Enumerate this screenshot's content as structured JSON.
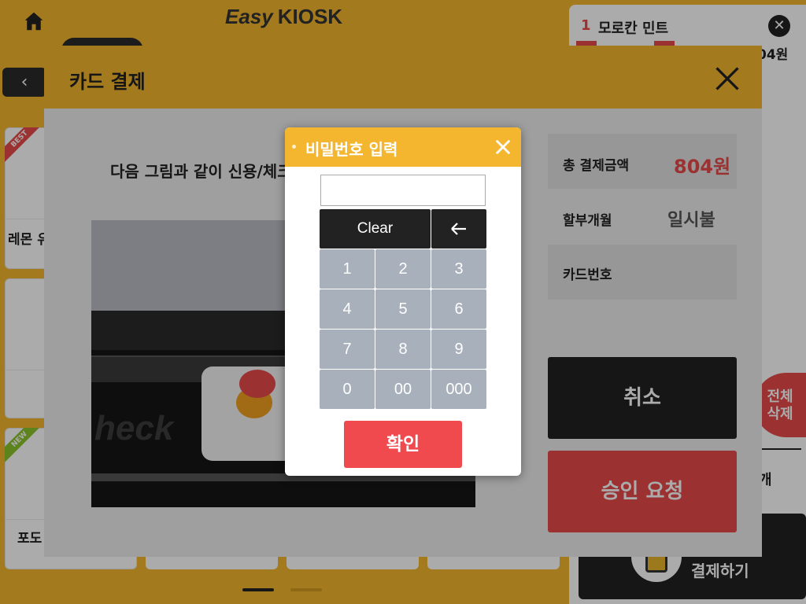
{
  "header": {
    "logo_part1": "Easy",
    "logo_part2": "KIOSK",
    "home_icon": "home-icon",
    "back_icon": "chevron-left-icon"
  },
  "products": [
    {
      "badge": "BEST",
      "name": "레몬 유"
    },
    {
      "badge": "",
      "name": ""
    },
    {
      "badge": "NEW",
      "name": "포도"
    }
  ],
  "cart": {
    "item_number": "1",
    "item_name": "모로칸 민트",
    "item_price_partial": "04원",
    "delete_all": "전체\n삭제",
    "count_unit": "개",
    "pay_label": "결제하기"
  },
  "card_payment": {
    "title": "카드 결제",
    "instruction": "다음 그림과 같이 신용/체크카드를 넣어주세요",
    "illustration_brand": "heck",
    "total_label": "총 결제금액",
    "total_value": "804원",
    "installment_label": "할부개월",
    "installment_value": "일시불",
    "card_number_label": "카드번호",
    "card_number_value": "",
    "cancel": "취소",
    "approve": "승인 요청"
  },
  "password_popup": {
    "title": "비밀번호 입력",
    "input_value": "",
    "input_placeholder": "",
    "clear": "Clear",
    "keys": [
      "1",
      "2",
      "3",
      "4",
      "5",
      "6",
      "7",
      "8",
      "9",
      "0",
      "00",
      "000"
    ],
    "confirm": "확인"
  },
  "colors": {
    "accent": "#f4b62e",
    "red": "#e84949",
    "dark": "#222222",
    "key": "#a8b0bb"
  }
}
